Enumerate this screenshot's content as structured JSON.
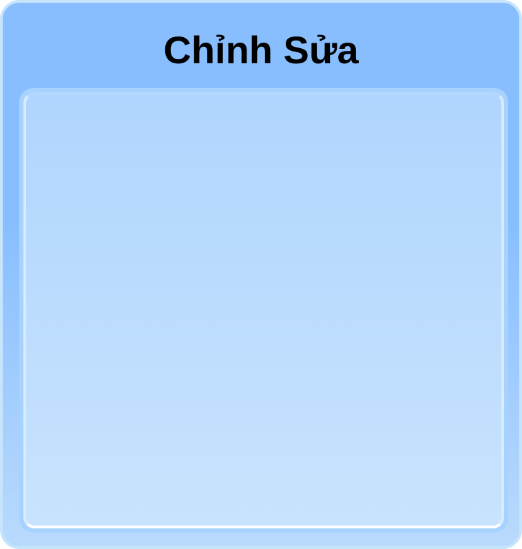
{
  "dialog": {
    "title": "Chỉnh Sửa"
  },
  "colors": {
    "header_background": "#88befe",
    "frame_border": "#c6e4fb",
    "content_background": "#b0d5fe",
    "content_highlight": "#ffffff",
    "title_text": "#000000"
  }
}
